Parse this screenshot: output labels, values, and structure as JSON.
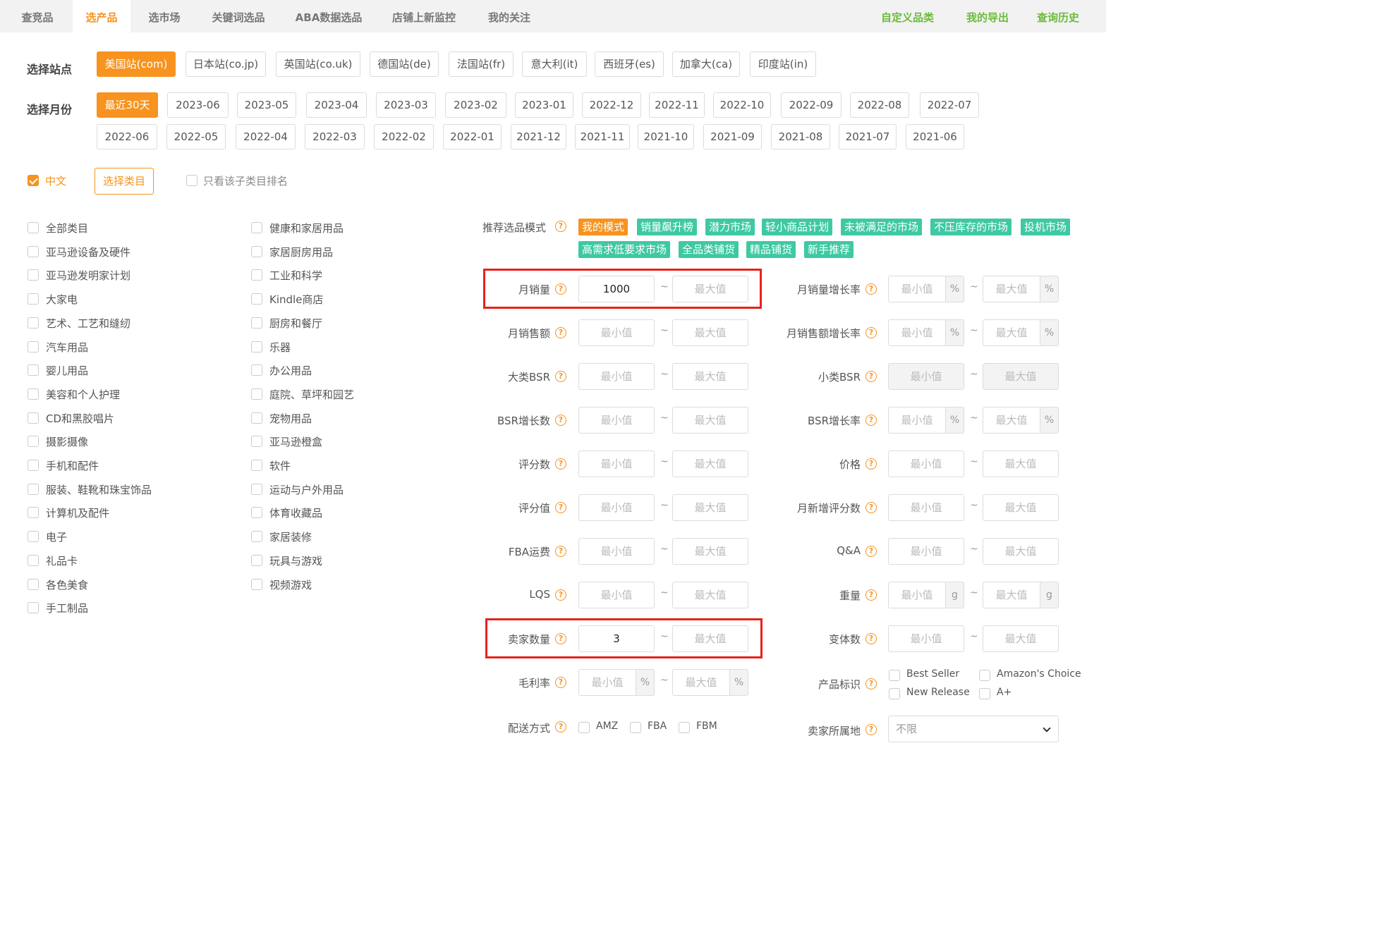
{
  "tabs": [
    "查竞品",
    "选产品",
    "选市场",
    "关键词选品",
    "ABA数据选品",
    "店铺上新监控",
    "我的关注"
  ],
  "right_links": [
    "自定义品类",
    "我的导出",
    "查询历史"
  ],
  "site": {
    "label": "选择站点",
    "options": [
      "美国站(com)",
      "日本站(co.jp)",
      "英国站(co.uk)",
      "德国站(de)",
      "法国站(fr)",
      "意大利(it)",
      "西班牙(es)",
      "加拿大(ca)",
      "印度站(in)"
    ]
  },
  "month": {
    "label": "选择月份",
    "row1": [
      "最近30天",
      "2023-06",
      "2023-05",
      "2023-04",
      "2023-03",
      "2023-02",
      "2023-01",
      "2022-12",
      "2022-11",
      "2022-10",
      "2022-09",
      "2022-08",
      "2022-07"
    ],
    "row2": [
      "2022-06",
      "2022-05",
      "2022-04",
      "2022-03",
      "2022-02",
      "2022-01",
      "2021-12",
      "2021-11",
      "2021-10",
      "2021-09",
      "2021-08",
      "2021-07",
      "2021-06"
    ]
  },
  "lang": {
    "label": "中文",
    "checked": true
  },
  "select_category": "选择类目",
  "only_sub": "只看该子类目排名",
  "categories_col1": [
    "全部类目",
    "亚马逊设备及硬件",
    "亚马逊发明家计划",
    "大家电",
    "艺术、工艺和缝纫",
    "汽车用品",
    "婴儿用品",
    "美容和个人护理",
    "CD和黑胶唱片",
    "摄影摄像",
    "手机和配件",
    "服装、鞋靴和珠宝饰品",
    "计算机及配件",
    "电子",
    "礼品卡",
    "各色美食",
    "手工制品"
  ],
  "categories_col2": [
    "健康和家居用品",
    "家居厨房用品",
    "工业和科学",
    "Kindle商店",
    "厨房和餐厅",
    "乐器",
    "办公用品",
    "庭院、草坪和园艺",
    "宠物用品",
    "亚马逊橙盒",
    "软件",
    "运动与户外用品",
    "体育收藏品",
    "家居装修",
    "玩具与游戏",
    "视频游戏"
  ],
  "mode": {
    "label": "推荐选品模式",
    "row1": [
      "我的模式",
      "销量飙升榜",
      "潜力市场",
      "轻小商品计划",
      "未被满足的市场",
      "不压库存的市场",
      "投机市场"
    ],
    "row2": [
      "高需求低要求市场",
      "全品类铺货",
      "精品铺货",
      "新手推荐"
    ]
  },
  "placeholders": {
    "min": "最小值",
    "max": "最大值"
  },
  "left_filters": {
    "monthly_sales": {
      "label": "月销量",
      "min": "1000"
    },
    "monthly_revenue": {
      "label": "月销售额"
    },
    "main_bsr": {
      "label": "大类BSR"
    },
    "bsr_growth_count": {
      "label": "BSR增长数"
    },
    "review_count": {
      "label": "评分数"
    },
    "rating": {
      "label": "评分值"
    },
    "fba_fee": {
      "label": "FBA运费"
    },
    "lqs": {
      "label": "LQS"
    },
    "seller_count": {
      "label": "卖家数量",
      "min": "3"
    },
    "gross_margin": {
      "label": "毛利率",
      "unit": "%"
    },
    "shipping": {
      "label": "配送方式",
      "options": [
        "AMZ",
        "FBA",
        "FBM"
      ]
    }
  },
  "right_filters": {
    "sales_growth": {
      "label": "月销量增长率",
      "unit": "%"
    },
    "revenue_growth": {
      "label": "月销售额增长率",
      "unit": "%"
    },
    "sub_bsr": {
      "label": "小类BSR"
    },
    "bsr_growth_rate": {
      "label": "BSR增长率",
      "unit": "%"
    },
    "price": {
      "label": "价格"
    },
    "new_reviews": {
      "label": "月新增评分数"
    },
    "qa": {
      "label": "Q&A"
    },
    "weight": {
      "label": "重量",
      "unit": "g"
    },
    "variants": {
      "label": "变体数"
    },
    "product_tags": {
      "label": "产品标识",
      "options": [
        "Best Seller",
        "Amazon's Choice",
        "New Release",
        "A+"
      ]
    },
    "seller_location": {
      "label": "卖家所属地",
      "value": "不限"
    }
  },
  "help_glyph": "?",
  "tilde": "~",
  "colors": {
    "accent": "#f7931e",
    "green_link": "#6cbb3c",
    "mode_green": "#3ec9a3",
    "highlight_red": "#e8221c"
  }
}
